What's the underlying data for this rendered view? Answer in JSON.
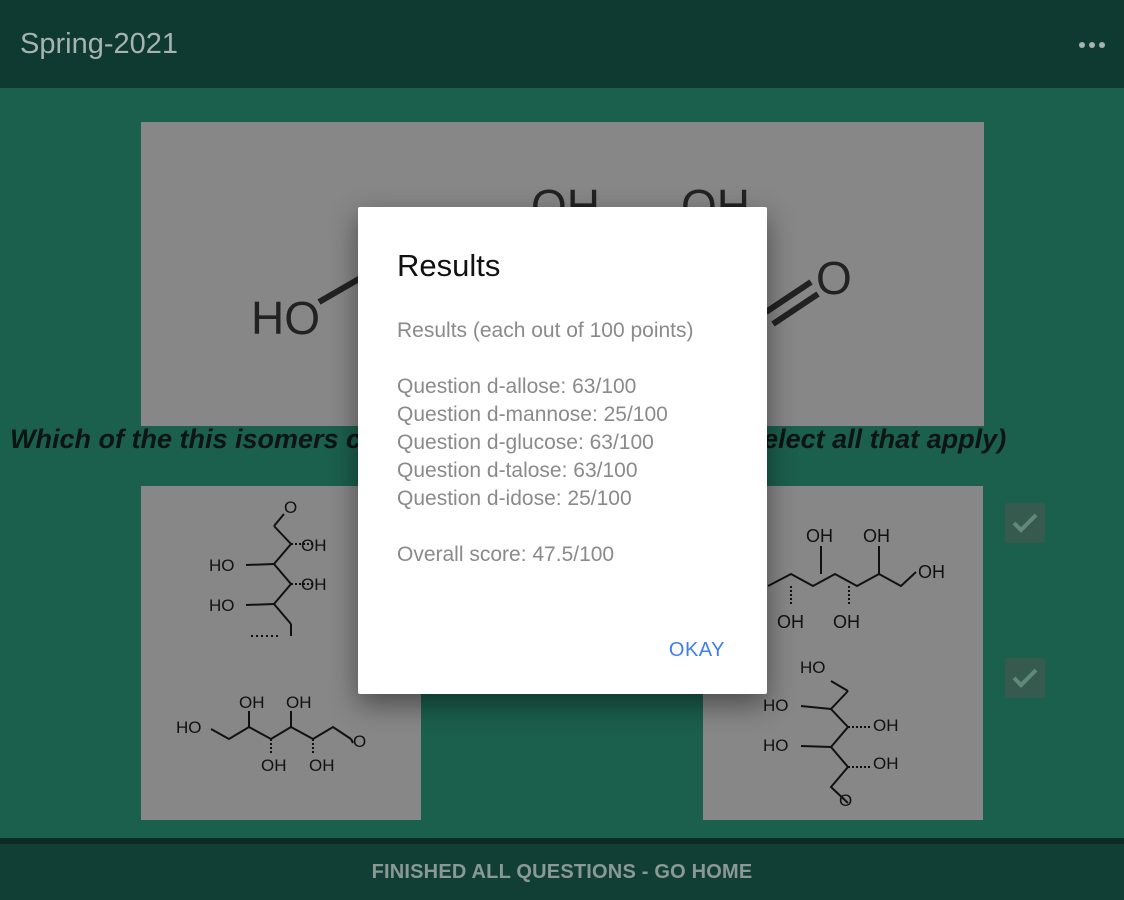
{
  "appbar": {
    "title": "Spring-2021",
    "menu_icon": "more-horiz-icon"
  },
  "question": {
    "text": "Which of the this isomers could be the structure above? (select all that apply)"
  },
  "structure_labels": {
    "ho": "HO",
    "oh": "OH",
    "o": "O"
  },
  "cards": {
    "top_left": {
      "labels": [
        "O",
        "OH",
        "HO",
        "OH",
        "HO"
      ]
    },
    "bottom_left": {
      "labels": [
        "OH",
        "OH",
        "HO",
        "O",
        "OH",
        "OH"
      ]
    },
    "top_right": {
      "labels": [
        "OH",
        "OH",
        "OH",
        "OH",
        "OH"
      ]
    },
    "bottom_right": {
      "labels": [
        "HO",
        "HO",
        "OH",
        "HO",
        "OH",
        "O"
      ]
    }
  },
  "checks": [
    {
      "checked": true
    },
    {
      "checked": true
    }
  ],
  "bottom_button": {
    "label": "FINISHED ALL QUESTIONS - GO HOME"
  },
  "dialog": {
    "title": "Results",
    "subtitle": "Results (each out of 100 points)",
    "lines": [
      "Question d-allose: 63/100",
      "Question d-mannose: 25/100",
      "Question d-glucose: 63/100",
      "Question d-talose: 63/100",
      "Question d-idose: 25/100"
    ],
    "overall": "Overall score: 47.5/100",
    "ok_label": "OKAY"
  },
  "colors": {
    "accent": "#3d7ef5",
    "appbar": "#0e3a31",
    "background": "#1b5f4d"
  }
}
